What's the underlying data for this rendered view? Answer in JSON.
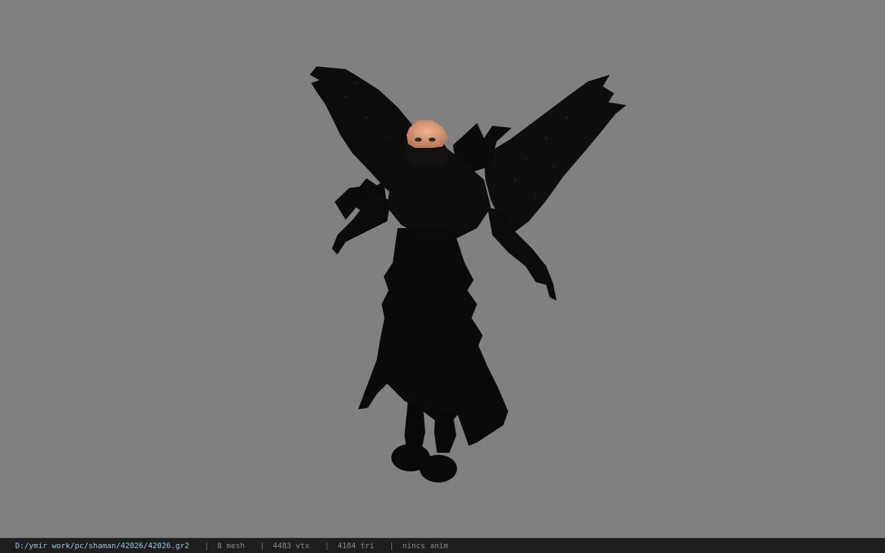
{
  "viewer": {
    "background_color": "#808080",
    "model_name": "winged-dark-armor-character"
  },
  "status_bar": {
    "file_path": "D:/ymir work/pc/shaman/42026/42026.gr2",
    "separator": "|",
    "mesh_count": "8 mesh",
    "vertex_count": "4483 vtx",
    "triangle_count": "4184 tri",
    "animation": "nincs anim",
    "path_color": "#9bc3da",
    "text_color": "#8a8a8a"
  }
}
